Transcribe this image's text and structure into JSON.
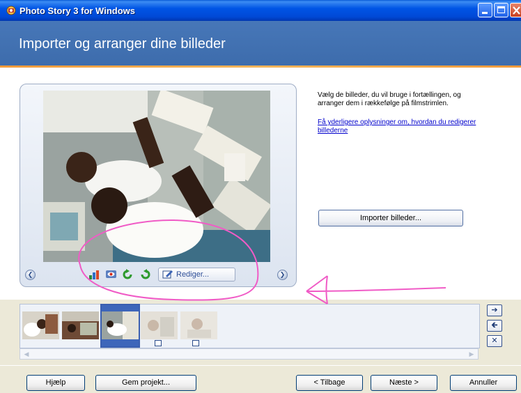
{
  "window": {
    "title": "Photo Story 3 for Windows"
  },
  "header": {
    "page_title": "Importer og arranger dine billeder"
  },
  "instructions": {
    "text": "Vælg de billeder, du vil bruge i fortællingen, og arranger dem i rækkefølge på filmstrimlen.",
    "link": "Få yderligere oplysninger om, hvordan du redigerer billederne"
  },
  "import_button": {
    "label": "Importer billeder..."
  },
  "preview_toolbar": {
    "edit_label": "Rediger...",
    "icons": [
      "auto-levels-icon",
      "red-eye-icon",
      "rotate-left-icon",
      "rotate-right-icon",
      "edit-icon"
    ]
  },
  "filmstrip": {
    "thumbnail_count": 5,
    "selected_index": 2
  },
  "bottom_buttons": {
    "help": "Hjælp",
    "save": "Gem projekt...",
    "back": "< Tilbage",
    "next": "Næste >",
    "cancel": "Annuller"
  },
  "colors": {
    "titlebar": "#0055E5",
    "header": "#4777B8",
    "accent_line": "#F09A3A",
    "annotation": "#F05BC6"
  }
}
